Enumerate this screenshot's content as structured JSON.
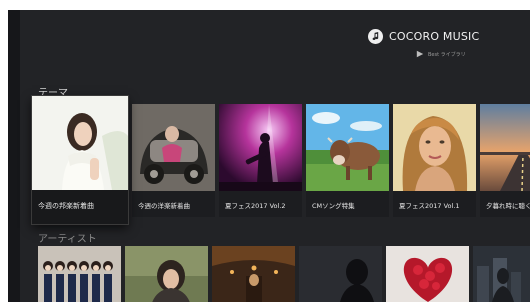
{
  "brand": {
    "name": "COCORO MUSIC",
    "sub_label": "Best ライブラリ",
    "logo_icon": "music-note-icon",
    "sub_icon": "play-triangle-icon"
  },
  "sections": {
    "theme_title": "テーマ",
    "artist_title": "アーティスト"
  },
  "theme_tiles": [
    {
      "label": "今週の邦楽新着曲",
      "icon": "singer-portrait-thumbnail",
      "focused": true
    },
    {
      "label": "今週の洋楽新着曲",
      "icon": "vintage-car-thumbnail",
      "focused": false
    },
    {
      "label": "夏フェス2017 Vol.2",
      "icon": "concert-stage-thumbnail",
      "focused": false
    },
    {
      "label": "CMソング特集",
      "icon": "cows-field-thumbnail",
      "focused": false
    },
    {
      "label": "夏フェス2017 Vol.1",
      "icon": "woman-portrait-thumbnail",
      "focused": false
    },
    {
      "label": "夕暮れ時に聴く",
      "icon": "sunset-road-thumbnail",
      "focused": false
    }
  ],
  "artist_tiles": [
    {
      "icon": "girl-group-thumbnail"
    },
    {
      "icon": "singer-outdoor-thumbnail"
    },
    {
      "icon": "concert-hall-thumbnail"
    },
    {
      "icon": "silhouette-thumbnail"
    },
    {
      "icon": "hearts-thumbnail"
    },
    {
      "icon": "city-night-thumbnail"
    }
  ],
  "colors": {
    "background": "#222326",
    "caption_bg": "#1c1d20",
    "text": "#e6e6e6"
  }
}
